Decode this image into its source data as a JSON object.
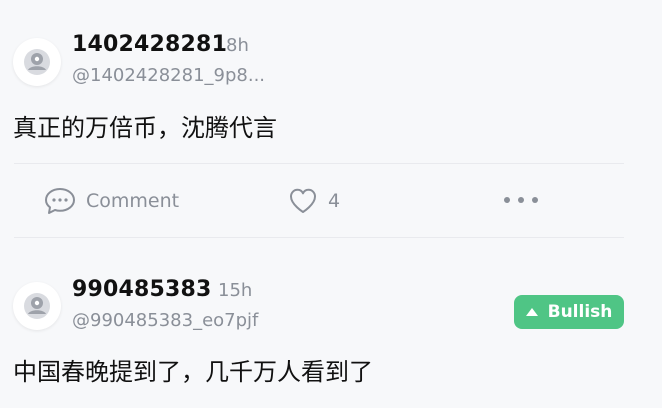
{
  "posts": [
    {
      "username": "1402428281",
      "time": "8h",
      "handle": "@1402428281_9p8...",
      "content": "真正的万倍币，沈腾代言",
      "actions": {
        "comment_label": "Comment",
        "like_count": "4"
      }
    },
    {
      "username": "990485383",
      "time": "15h",
      "handle": "@990485383_eo7pjf",
      "content": "中国春晚提到了，几千万人看到了",
      "badge": "Bullish"
    }
  ],
  "icons": {
    "avatar": "default-avatar-icon",
    "comment": "comment-bubble-icon",
    "like": "heart-icon",
    "more": "more-horizontal-icon",
    "bullish": "triangle-up-icon"
  },
  "colors": {
    "background": "#f7f8fa",
    "text_primary": "#111111",
    "text_secondary": "#8a8f98",
    "bullish": "#4fc585"
  }
}
